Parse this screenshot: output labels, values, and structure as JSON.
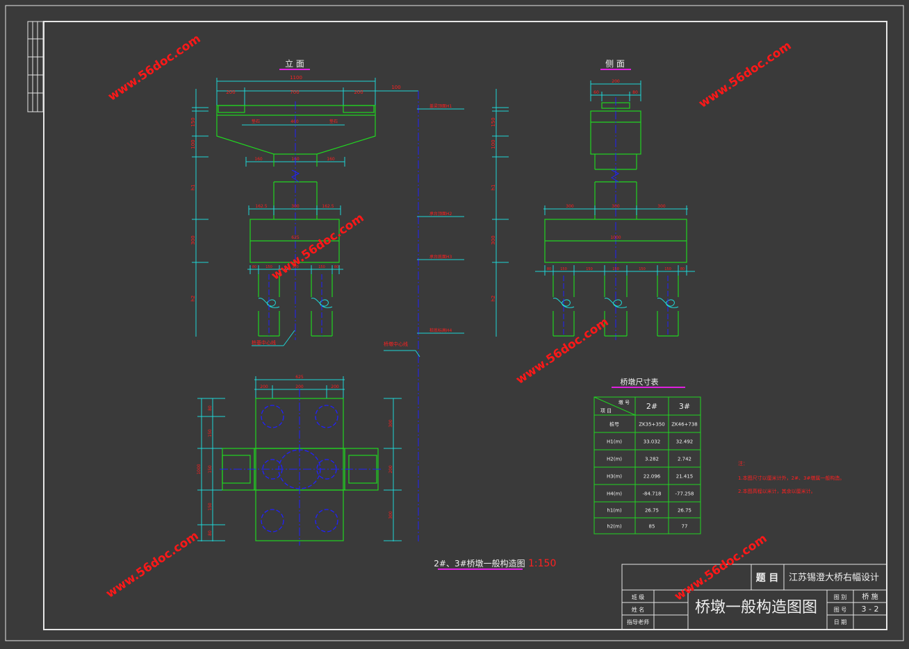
{
  "colors": {
    "background": "#3a3a3a",
    "frame": "#e6e6e6",
    "green": "#21d521",
    "blue": "#2020ff",
    "cyan": "#1fd7d7",
    "red": "#ff2020",
    "magenta": "#e020e0",
    "yellow": "#e8e800",
    "white": "#f0f0f0",
    "watermark": "#ff1818"
  },
  "views": {
    "front": "立  面",
    "side": "侧  面"
  },
  "front_dims": {
    "total": "1100",
    "left": "200",
    "mid": "700",
    "right": "200",
    "offset": "100",
    "col_seg_left": "160",
    "col_seg_mid": "160",
    "col_seg_right": "160"
  },
  "side_dims": {
    "top": "200",
    "top_left": "60",
    "top_right": "80",
    "foot_left": "300",
    "foot_mid": "300",
    "foot_right": "300",
    "foot_total": "1000"
  },
  "elevation_labels": {
    "e1": "盖梁顶面H1",
    "e2": "承台顶面H2",
    "e3": "承台底面H3",
    "e4": "桩底标高H4"
  },
  "callouts": {
    "pile_axis": "桩基中心线",
    "pier_axis": "桥墩中心线"
  },
  "plan_dims": {
    "top": "625",
    "top_left": "200",
    "top_mid": "200",
    "top_right": "200",
    "left_total": "1000"
  },
  "table": {
    "title": "桥墩尺寸表",
    "header_no": "墩  号",
    "header_item": "项  目",
    "cols": [
      "2#",
      "3#"
    ],
    "rows": [
      {
        "label": "桩号",
        "v2": "ZK35+350",
        "v3": "ZK46+738"
      },
      {
        "label": "H1(m)",
        "v2": "33.032",
        "v3": "32.492"
      },
      {
        "label": "H2(m)",
        "v2": "3.282",
        "v3": "2.742"
      },
      {
        "label": "H3(m)",
        "v2": "22.096",
        "v3": "21.415"
      },
      {
        "label": "H4(m)",
        "v2": "-84.718",
        "v3": "-77.258"
      },
      {
        "label": "h1(m)",
        "v2": "26.75",
        "v3": "26.75"
      },
      {
        "label": "h2(m)",
        "v2": "85",
        "v3": "77"
      }
    ]
  },
  "notes": {
    "head": "注：",
    "n1": "1.本图尺寸以厘米计外，2#、3#墩属一般构造。",
    "n2": "2.本图高程以米计，其余以厘米计。"
  },
  "drawing_title": "2#、3#桥墩一般构造图",
  "scale": "1:150",
  "title_block": {
    "topic_label": "题  目",
    "topic": "江苏锡澄大桥右幅设计",
    "class_label": "班  级",
    "name_label": "姓  名",
    "advisor_label": "指导老师",
    "drawing_name": "桥墩一般构造图图",
    "cat_label": "图  别",
    "cat_value": "桥  施",
    "num_label": "图  号",
    "num_value": "3 - 2",
    "date_label": "日  期"
  },
  "watermark": "www.56doc.com"
}
